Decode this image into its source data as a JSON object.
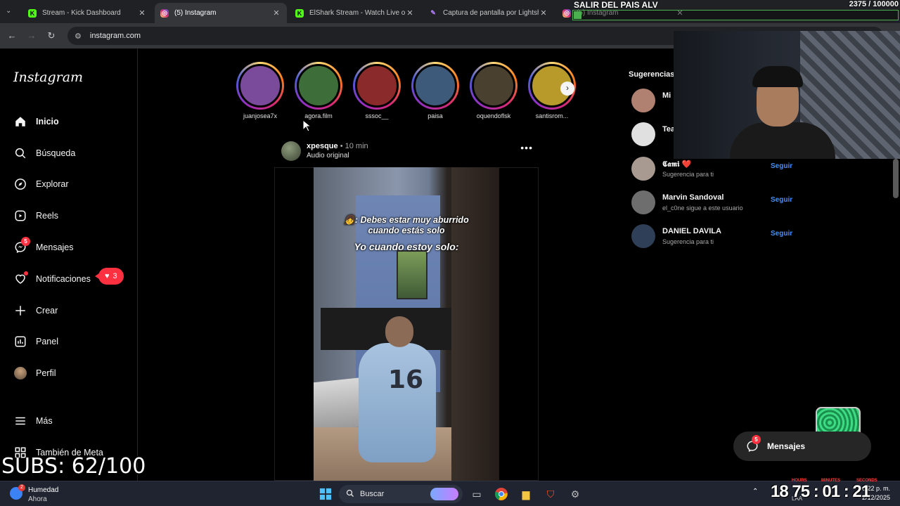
{
  "browser": {
    "tabs": [
      {
        "title": "Stream - Kick Dashboard",
        "favicon": "kick",
        "active": false
      },
      {
        "title": "(5) Instagram",
        "favicon": "instagram",
        "active": true
      },
      {
        "title": "ElShark Stream - Watch Live on",
        "favicon": "kick",
        "active": false
      },
      {
        "title": "Captura de pantalla por Lightsh",
        "favicon": "lightshot",
        "active": false
      },
      {
        "title": "(5) Instagram",
        "favicon": "instagram",
        "active": false
      }
    ],
    "url": "instagram.com"
  },
  "sidebar": {
    "logo": "Instagram",
    "items": [
      {
        "label": "Inicio",
        "icon": "home-icon"
      },
      {
        "label": "Búsqueda",
        "icon": "search-icon"
      },
      {
        "label": "Explorar",
        "icon": "compass-icon"
      },
      {
        "label": "Reels",
        "icon": "reels-icon"
      },
      {
        "label": "Mensajes",
        "icon": "messenger-icon",
        "badge": "5"
      },
      {
        "label": "Notificaciones",
        "icon": "heart-icon"
      },
      {
        "label": "Crear",
        "icon": "plus-icon"
      },
      {
        "label": "Panel",
        "icon": "chart-icon"
      },
      {
        "label": "Perfil",
        "icon": "avatar"
      },
      {
        "label": "Más",
        "icon": "menu-icon"
      },
      {
        "label": "También de Meta",
        "icon": "grid-icon"
      }
    ],
    "notif_pill_count": "3"
  },
  "stories": [
    {
      "user": "juanjosea7x",
      "color": "#7a4b9a"
    },
    {
      "user": "agora.film",
      "color": "#3d6e3a"
    },
    {
      "user": "sssoc__",
      "color": "#8a2a2a"
    },
    {
      "user": "paisa",
      "color": "#3e5a7a"
    },
    {
      "user": "oquendoflsk",
      "color": "#4a4030"
    },
    {
      "user": "santisrom...",
      "color": "#b89a2a"
    }
  ],
  "post": {
    "user": "xpesque",
    "time": "• 10 min",
    "audio": "Audio original",
    "caption_line1": "👧: Debes estar muy aburrido",
    "caption_line2": "cuando estás solo",
    "caption_line3": "Yo cuando estoy solo:",
    "jersey_number": "16"
  },
  "suggestions": {
    "title": "Sugerencias",
    "follow_label": "Seguir",
    "items": [
      {
        "name": "Mi",
        "sub": "",
        "color": "#b08070",
        "show_follow": false
      },
      {
        "name": "Tea",
        "sub": "",
        "color": "#e0e0e0",
        "show_follow": false
      },
      {
        "name": "𝕮𝖆𝖒𝖎 ❤️",
        "sub": "Sugerencia para ti",
        "color": "#a89a90",
        "show_follow": true
      },
      {
        "name": "Marvin Sandoval",
        "sub": "el_c0ne sigue a este usuario",
        "color": "#6e6e6e",
        "show_follow": true
      },
      {
        "name": "DANIEL DAVILA",
        "sub": "Sugerencia para ti",
        "color": "#2f3f57",
        "show_follow": true
      }
    ]
  },
  "floating_messages": {
    "label": "Mensajes",
    "badge": "5"
  },
  "overlay": {
    "goal_title": "SALIR DEL PAIS ALV",
    "goal_count": "2375 / 100000",
    "goal_progress": 0.024,
    "subs_goal": "SUBS: 62/100",
    "timer": "18 75 : 01 : 21",
    "timer_labels": [
      "HOURS",
      "MINUTES",
      "SECONDS"
    ]
  },
  "taskbar": {
    "weather_title": "Humedad",
    "weather_sub": "Ahora",
    "weather_badge": "2",
    "search_placeholder": "Buscar",
    "clock_time": "6:22 p. m.",
    "clock_date": "2/12/2025",
    "lang": "LAA"
  }
}
